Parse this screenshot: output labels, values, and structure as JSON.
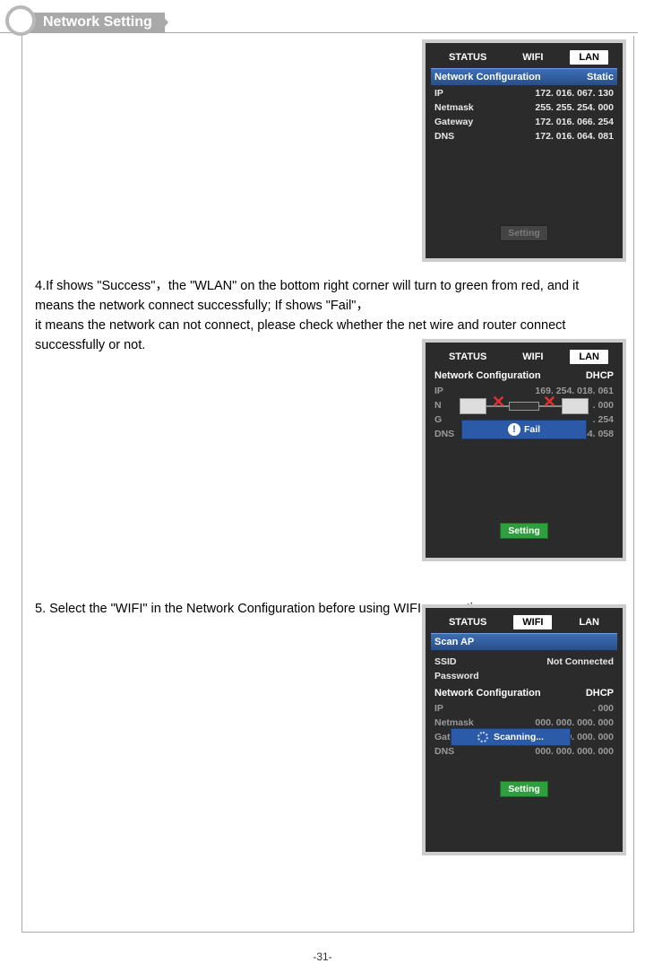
{
  "header": {
    "title": "Network Setting"
  },
  "para1": "4.If shows \"Success\"，the   \"WLAN\" on the bottom right corner will turn to green from red, and it means the network connect successfully; If shows \"Fail\"，",
  "para1b": "it means the network can not connect, please check whether the net wire and router  connect successfully or not.",
  "para2": "5. Select the \"WIFI\" in the Network Configuration before using WIFI connecting.",
  "tabs": {
    "status": "STATUS",
    "wifi": "WIFI",
    "lan": "LAN"
  },
  "labels": {
    "netconf": "Network Configuration",
    "ip": "IP",
    "netmask": "Netmask",
    "gateway": "Gateway",
    "dns": "DNS",
    "setting": "Setting",
    "scanap": "Scan AP",
    "ssid": "SSID",
    "password": "Password",
    "fail": "Fail",
    "scanning": "Scanning...",
    "notconn": "Not Connected"
  },
  "modes": {
    "static": "Static",
    "dhcp": "DHCP"
  },
  "panel1": {
    "ip": "172. 016. 067. 130",
    "netmask": "255. 255. 254. 000",
    "gateway": "172. 016. 066. 254",
    "dns": "172. 016. 064. 081"
  },
  "panel2": {
    "ip": "169. 254. 018. 061",
    "netmask": ". 000",
    "gateway": ". 254",
    "dns": "172. 016. 064. 058"
  },
  "panel3": {
    "ip": ". 000",
    "netmask": "000. 000. 000. 000",
    "gateway": "000. 000. 000. 000",
    "dns": "000. 000. 000. 000"
  },
  "pageNum": "-31-"
}
